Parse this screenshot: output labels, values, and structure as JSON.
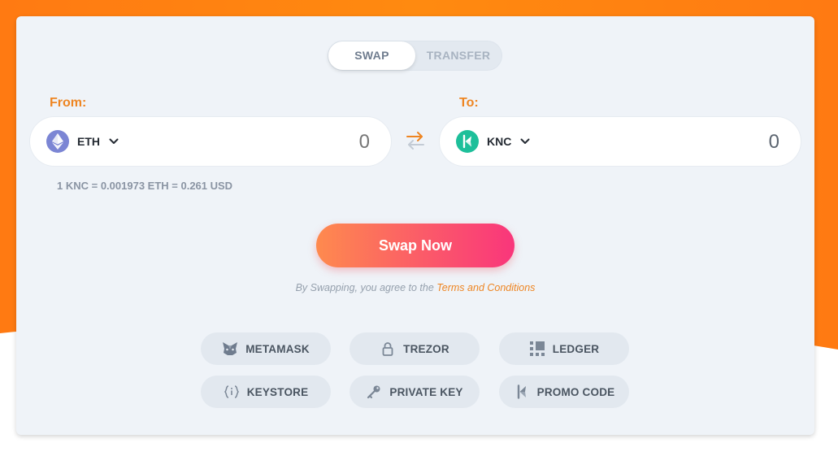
{
  "tabs": {
    "swap": "SWAP",
    "transfer": "TRANSFER",
    "active": "swap"
  },
  "from": {
    "label": "From:",
    "token": "ETH",
    "amount_placeholder": "0"
  },
  "to": {
    "label": "To:",
    "token": "KNC",
    "amount": "0"
  },
  "rate": "1 KNC = 0.001973 ETH = 0.261 USD",
  "swap_button": "Swap Now",
  "terms": {
    "prefix": "By Swapping, you agree to the ",
    "link": "Terms and Conditions"
  },
  "wallets": [
    {
      "label": "METAMASK",
      "icon": "metamask-fox-icon"
    },
    {
      "label": "TREZOR",
      "icon": "lock-icon"
    },
    {
      "label": "LEDGER",
      "icon": "ledger-icon"
    },
    {
      "label": "KEYSTORE",
      "icon": "keystore-braces-icon"
    },
    {
      "label": "PRIVATE KEY",
      "icon": "key-icon"
    },
    {
      "label": "PROMO CODE",
      "icon": "kyber-promo-icon"
    }
  ],
  "colors": {
    "background": "#ff7a12",
    "accent": "#ee8522",
    "card": "#eff3f8",
    "button_start": "#fe8a4e",
    "button_end": "#f9367b"
  }
}
